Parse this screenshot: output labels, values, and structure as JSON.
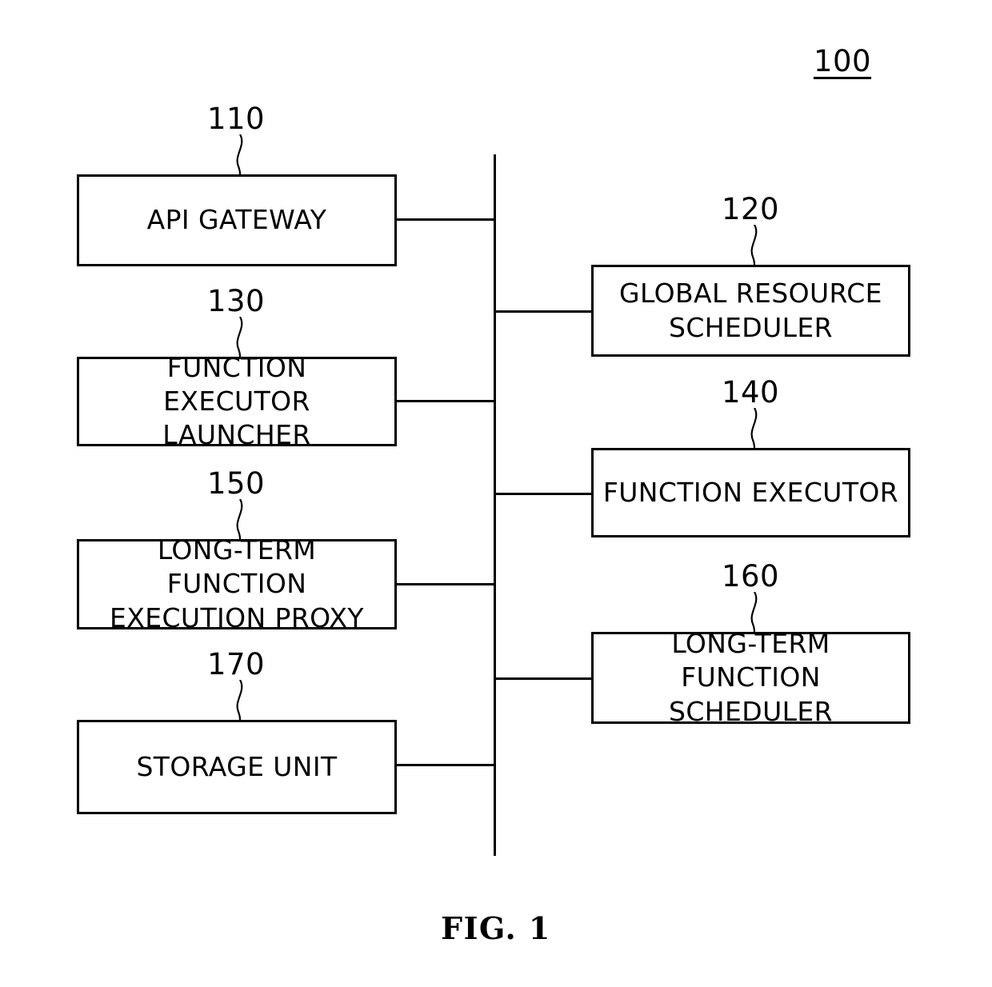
{
  "figure": {
    "caption": "FIG. 1",
    "system_ref": "100"
  },
  "left_column": [
    {
      "ref": "110",
      "label": "API GATEWAY"
    },
    {
      "ref": "130",
      "label": "FUNCTION\nEXECUTOR LAUNCHER"
    },
    {
      "ref": "150",
      "label": "LONG-TERM FUNCTION\nEXECUTION PROXY"
    },
    {
      "ref": "170",
      "label": "STORAGE UNIT"
    }
  ],
  "right_column": [
    {
      "ref": "120",
      "label": "GLOBAL RESOURCE\nSCHEDULER"
    },
    {
      "ref": "140",
      "label": "FUNCTION EXECUTOR"
    },
    {
      "ref": "160",
      "label": "LONG-TERM\nFUNCTION SCHEDULER"
    }
  ],
  "colors": {
    "ink": "#000000",
    "paper": "#ffffff"
  }
}
